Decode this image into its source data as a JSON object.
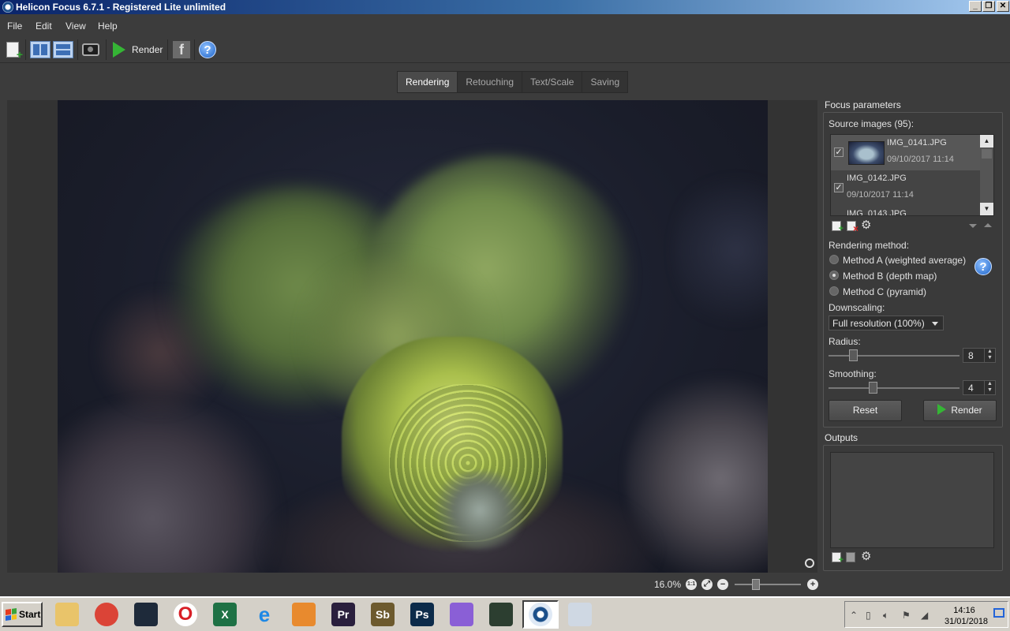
{
  "window": {
    "title": "Helicon Focus 6.7.1 - Registered Lite unlimited",
    "controls": [
      "_",
      "❐",
      "✕"
    ]
  },
  "menu": [
    "File",
    "Edit",
    "View",
    "Help"
  ],
  "toolbar": {
    "render_label": "Render",
    "facebook_glyph": "f",
    "help_glyph": "?"
  },
  "tabs": [
    "Rendering",
    "Retouching",
    "Text/Scale",
    "Saving"
  ],
  "active_tab": "Rendering",
  "zoom": {
    "label": "16.0%",
    "value_percent": 16.0,
    "fit_glyph": "1:1",
    "minus": "−",
    "plus": "+"
  },
  "focus_params": {
    "title": "Focus parameters",
    "source_label": "Source images (95):",
    "images": [
      {
        "name": "IMG_0141.JPG",
        "date": "09/10/2017 11:14",
        "checked": true,
        "selected": true
      },
      {
        "name": "IMG_0142.JPG",
        "date": "09/10/2017 11:14",
        "checked": true,
        "selected": false
      },
      {
        "name": "IMG_0143.JPG",
        "date": "",
        "checked": false,
        "selected": false
      }
    ],
    "check_glyph": "✓",
    "rendering_method_label": "Rendering method:",
    "methods": [
      {
        "label": "Method A (weighted average)",
        "selected": false
      },
      {
        "label": "Method B (depth map)",
        "selected": true
      },
      {
        "label": "Method C (pyramid)",
        "selected": false
      }
    ],
    "help_glyph": "?",
    "downscaling_label": "Downscaling:",
    "downscaling_value": "Full resolution (100%)",
    "radius_label": "Radius:",
    "radius_value": "8",
    "radius_fraction": 0.17,
    "smoothing_label": "Smoothing:",
    "smoothing_value": "4",
    "smoothing_fraction": 0.34,
    "spin_arrows": "▲▼",
    "reset_label": "Reset",
    "render_label": "Render"
  },
  "outputs": {
    "title": "Outputs"
  },
  "taskbar": {
    "start_label": "Start",
    "apps": [
      {
        "name": "file-manager",
        "glyph": "",
        "color": "#e9c46a"
      },
      {
        "name": "chrome",
        "glyph": "",
        "color": "#db4437"
      },
      {
        "name": "monitor-app",
        "glyph": "",
        "color": "#1e2a3a"
      },
      {
        "name": "opera",
        "glyph": "O",
        "color": "#d81f26"
      },
      {
        "name": "excel",
        "glyph": "X",
        "color": "#1e7145"
      },
      {
        "name": "internet-explorer",
        "glyph": "e",
        "color": "#1e88e5"
      },
      {
        "name": "media-app",
        "glyph": "",
        "color": "#e88a2e"
      },
      {
        "name": "premiere",
        "glyph": "Pr",
        "color": "#2a1f3d"
      },
      {
        "name": "storyboard",
        "glyph": "Sb",
        "color": "#6d5a2e"
      },
      {
        "name": "photoshop",
        "glyph": "Ps",
        "color": "#0c2b4a"
      },
      {
        "name": "cat-app",
        "glyph": "",
        "color": "#8a5fd6"
      },
      {
        "name": "system-monitor",
        "glyph": "",
        "color": "#2c3e30"
      },
      {
        "name": "helicon-focus",
        "glyph": "",
        "color": "#1b4f8a"
      },
      {
        "name": "paint",
        "glyph": "",
        "color": "#cfd8e3"
      }
    ],
    "clock_time": "14:16",
    "clock_date": "31/01/2018"
  }
}
